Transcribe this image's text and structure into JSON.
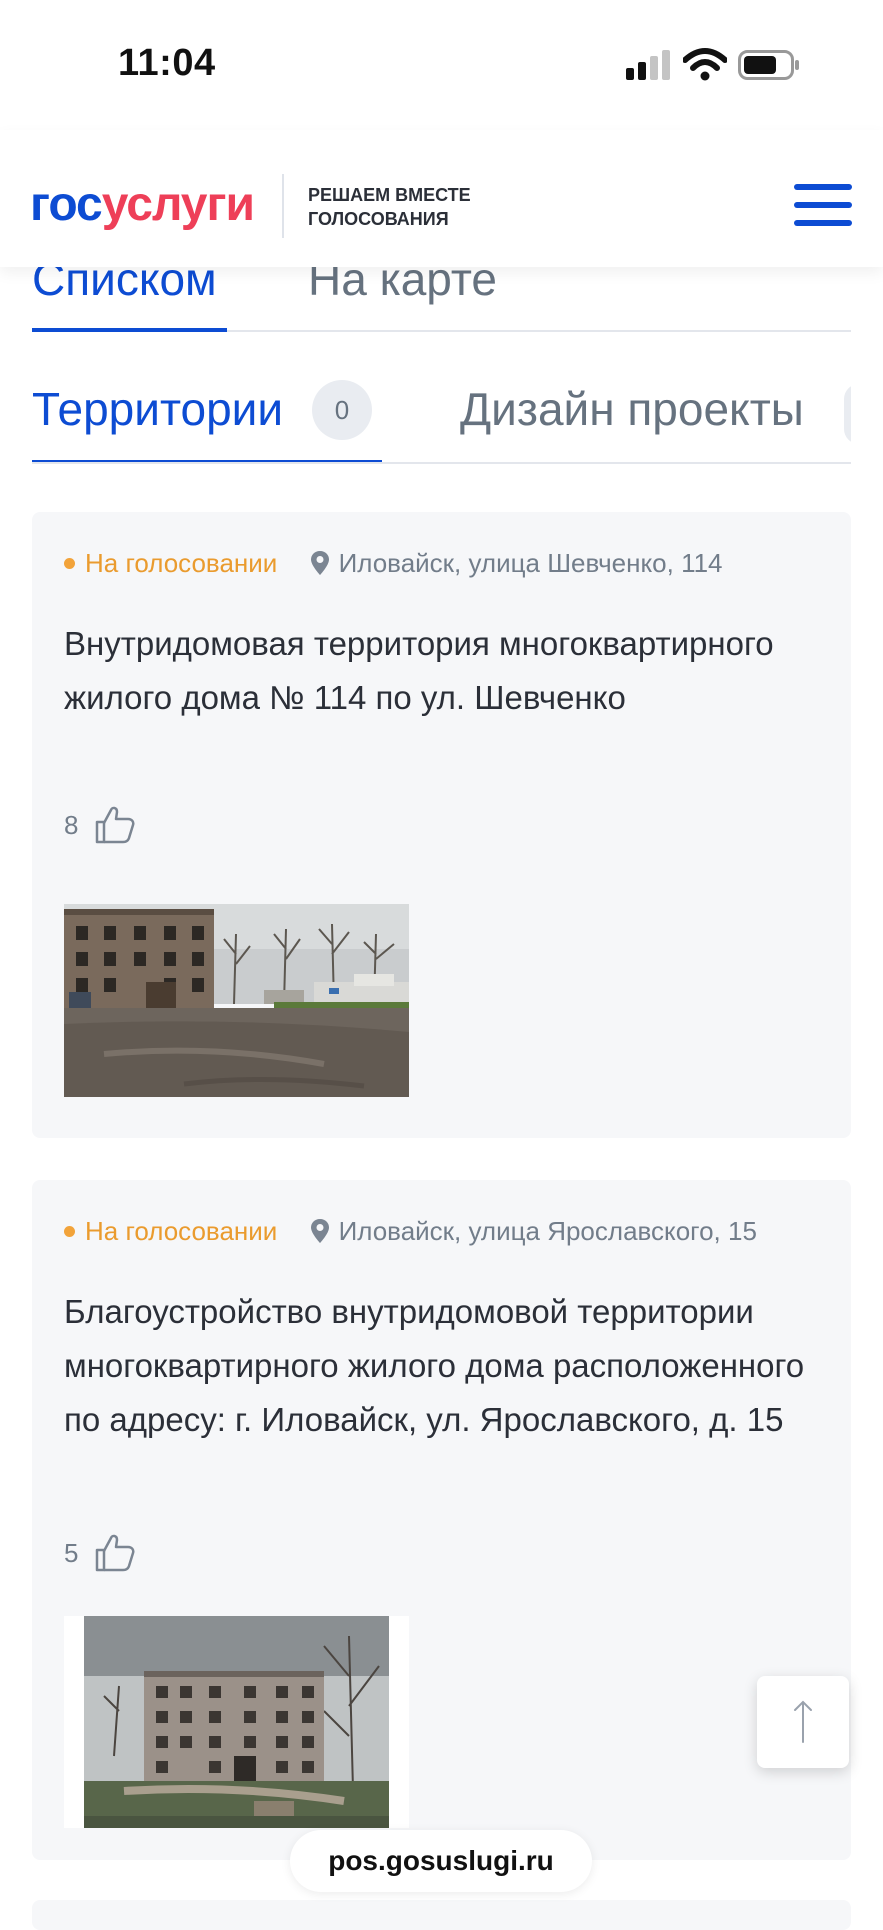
{
  "status_bar": {
    "time": "11:04"
  },
  "header": {
    "logo_part1": "гос",
    "logo_part2": "услуги",
    "tagline_line1": "РЕШАЕМ ВМЕСТЕ",
    "tagline_line2": "ГОЛОСОВАНИЯ"
  },
  "view_tabs": {
    "list": "Списком",
    "map": "На карте"
  },
  "category_tabs": {
    "territories": "Территории",
    "territories_count": "0",
    "design_projects": "Дизайн проекты"
  },
  "cards": [
    {
      "status": "На голосовании",
      "address": "Иловайск, улица Шевченко, 114",
      "title": "Внутридомовая территория многоквартирного жилого дома № 114 по ул. Шевченко",
      "likes": "8"
    },
    {
      "status": "На голосовании",
      "address": "Иловайск, улица Ярославского, 15",
      "title": "Благоустройство внутридомовой территории многоквартирного жилого дома расположенного по адресу: г. Иловайск, ул. Ярославского, д. 15",
      "likes": "5"
    }
  ],
  "browser": {
    "url": "pos.gosuslugi.ru"
  },
  "colors": {
    "brand_blue": "#0d4cd3",
    "brand_red": "#ee3f58",
    "status_orange": "#ea9b2e"
  }
}
